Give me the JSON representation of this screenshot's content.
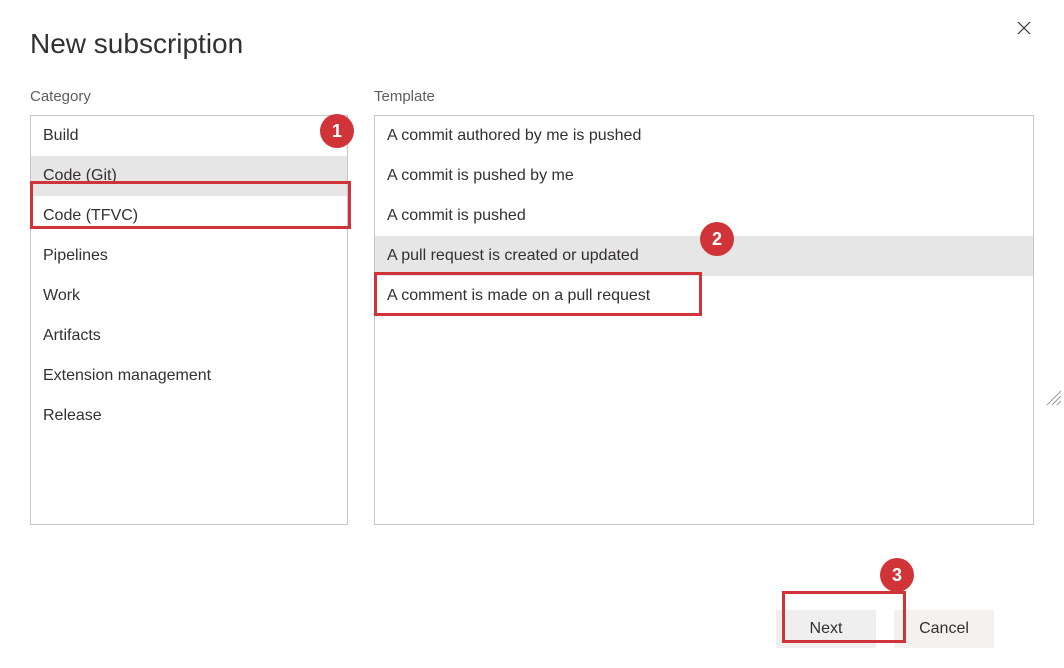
{
  "title": "New subscription",
  "labels": {
    "category": "Category",
    "template": "Template"
  },
  "categories": [
    {
      "label": "Build",
      "selected": false
    },
    {
      "label": "Code (Git)",
      "selected": true
    },
    {
      "label": "Code (TFVC)",
      "selected": false
    },
    {
      "label": "Pipelines",
      "selected": false
    },
    {
      "label": "Work",
      "selected": false
    },
    {
      "label": "Artifacts",
      "selected": false
    },
    {
      "label": "Extension management",
      "selected": false
    },
    {
      "label": "Release",
      "selected": false
    }
  ],
  "templates": [
    {
      "label": "A commit authored by me is pushed",
      "selected": false
    },
    {
      "label": "A commit is pushed by me",
      "selected": false
    },
    {
      "label": "A commit is pushed",
      "selected": false
    },
    {
      "label": "A pull request is created or updated",
      "selected": true
    },
    {
      "label": "A comment is made on a pull request",
      "selected": false
    }
  ],
  "buttons": {
    "next": "Next",
    "cancel": "Cancel"
  },
  "annotations": {
    "one": "1",
    "two": "2",
    "three": "3"
  },
  "annotation_color": "#d13438"
}
